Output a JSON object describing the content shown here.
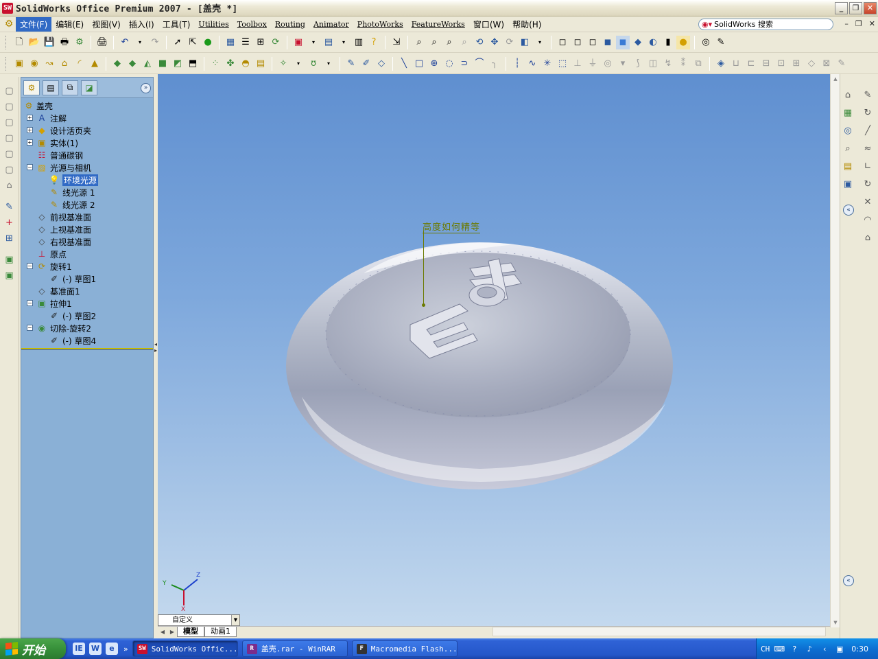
{
  "window": {
    "title": "SolidWorks Office Premium 2007 - [盖壳 *]",
    "app_icon_text": "SW",
    "buttons": [
      "_",
      "❐",
      "✕"
    ]
  },
  "menu": {
    "items": [
      "文件(F)",
      "编辑(E)",
      "视图(V)",
      "插入(I)",
      "工具(T)",
      "Utilities",
      "Toolbox",
      "Routing",
      "Animator",
      "PhotoWorks",
      "FeatureWorks",
      "窗口(W)",
      "帮助(H)"
    ],
    "active_index": 0,
    "search_label": "SolidWorks 搜索",
    "mdi_buttons": [
      "–",
      "❐",
      "✕"
    ]
  },
  "feature_tree": {
    "root": "盖壳",
    "items": [
      {
        "label": "注解",
        "icon": "annotations-icon",
        "expander": "+",
        "level": 1
      },
      {
        "label": "设计活页夹",
        "icon": "design-binder-icon",
        "expander": "+",
        "level": 1
      },
      {
        "label": "实体(1)",
        "icon": "solid-bodies-icon",
        "expander": "+",
        "level": 1
      },
      {
        "label": "普通碳钢",
        "icon": "material-icon",
        "expander": "",
        "level": 1
      },
      {
        "label": "光源与相机",
        "icon": "lights-cameras-icon",
        "expander": "−",
        "level": 1
      },
      {
        "label": "环境光源",
        "icon": "ambient-light-icon",
        "expander": "",
        "level": 2,
        "selected": true
      },
      {
        "label": "线光源 1",
        "icon": "directional-light-icon",
        "expander": "",
        "level": 2
      },
      {
        "label": "线光源 2",
        "icon": "directional-light-icon",
        "expander": "",
        "level": 2
      },
      {
        "label": "前视基准面",
        "icon": "plane-icon",
        "expander": "",
        "level": 1
      },
      {
        "label": "上视基准面",
        "icon": "plane-icon",
        "expander": "",
        "level": 1
      },
      {
        "label": "右视基准面",
        "icon": "plane-icon",
        "expander": "",
        "level": 1
      },
      {
        "label": "原点",
        "icon": "origin-icon",
        "expander": "",
        "level": 1
      },
      {
        "label": "旋转1",
        "icon": "revolve-icon",
        "expander": "−",
        "level": 1
      },
      {
        "label": "(-) 草图1",
        "icon": "sketch-icon",
        "expander": "",
        "level": 2
      },
      {
        "label": "基准面1",
        "icon": "plane-icon",
        "expander": "",
        "level": 1
      },
      {
        "label": "拉伸1",
        "icon": "extrude-icon",
        "expander": "−",
        "level": 1
      },
      {
        "label": "(-) 草图2",
        "icon": "sketch-icon",
        "expander": "",
        "level": 2
      },
      {
        "label": "切除-旋转2",
        "icon": "cut-revolve-icon",
        "expander": "−",
        "level": 1
      },
      {
        "label": "(-) 草图4",
        "icon": "sketch-icon",
        "expander": "",
        "level": 2
      }
    ]
  },
  "viewport": {
    "annotation": "高度如何精等",
    "triad_axes": [
      "Y",
      "Z",
      "X"
    ]
  },
  "bottom": {
    "configuration": "自定义",
    "tabs": [
      "模型",
      "动画1"
    ],
    "active_tab": 0
  },
  "taskbar": {
    "start_label": "开始",
    "quick_launch": [
      "IE",
      "W",
      "e"
    ],
    "quick_more": "»",
    "buttons": [
      {
        "label": "SolidWorks Offic...",
        "icon_text": "SW",
        "icon_color": "#c8102e",
        "active": true
      },
      {
        "label": "盖壳.rar - WinRAR",
        "icon_text": "R",
        "icon_color": "#7a2c8c",
        "active": false
      },
      {
        "label": "Macromedia Flash...",
        "icon_text": "F",
        "icon_color": "#333333",
        "active": false
      }
    ],
    "tray_lang": "CH",
    "clock": "0:30"
  },
  "colors": {
    "viewport_top": "#5f8fd0",
    "viewport_bottom": "#c4d9ee",
    "panel_bg": "#8ab0d6",
    "annotation": "#6b7a00",
    "selection": "#316ac5"
  }
}
